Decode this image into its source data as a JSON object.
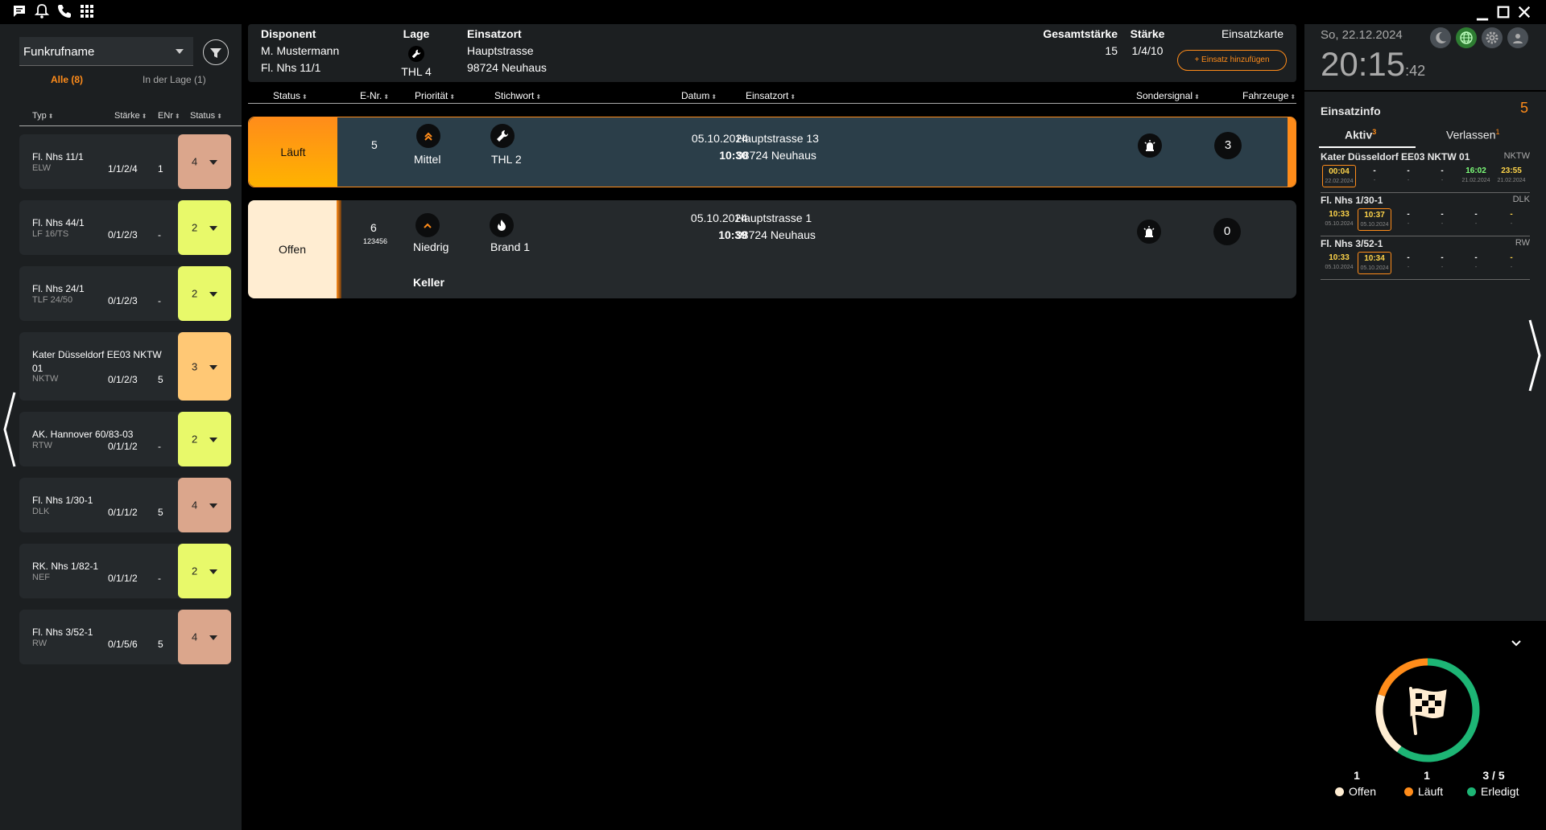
{
  "colors": {
    "accent": "#ff8c1a",
    "status2": "#e8f96a",
    "status3": "#ffc875",
    "status4": "#dba68c",
    "offen": "#ffedd2",
    "laeuft": "#ff8c1a",
    "erledigt": "#1db575",
    "timeGreen": "#7dff7a",
    "timeYellow": "#ffd54a"
  },
  "topbar": {
    "icons": [
      "message-icon",
      "bell-icon",
      "phone-icon",
      "grid-icon"
    ],
    "window": [
      "minimize-icon",
      "maximize-icon",
      "close-icon"
    ]
  },
  "left": {
    "select": {
      "value": "Funkrufname"
    },
    "tabs": [
      {
        "label": "Alle (8)",
        "active": true
      },
      {
        "label": "In der Lage (1)",
        "active": false
      }
    ],
    "columns": [
      "Typ",
      "Stärke",
      "ENr",
      "Status"
    ],
    "units": [
      {
        "name": "Fl. Nhs 11/1",
        "type": "ELW",
        "staerke": "1/1/2/4",
        "enr": "1",
        "status": "4",
        "color": "#dba68c"
      },
      {
        "name": "Fl. Nhs 44/1",
        "type": "LF 16/TS",
        "staerke": "0/1/2/3",
        "enr": "-",
        "status": "2",
        "color": "#e8f96a"
      },
      {
        "name": "Fl. Nhs 24/1",
        "type": "TLF 24/50",
        "staerke": "0/1/2/3",
        "enr": "-",
        "status": "2",
        "color": "#e8f96a"
      },
      {
        "name": "Kater Düsseldorf EE03 NKTW 01",
        "type": "NKTW",
        "staerke": "0/1/2/3",
        "enr": "5",
        "status": "3",
        "color": "#ffc875"
      },
      {
        "name": "AK. Hannover 60/83-03",
        "type": "RTW",
        "staerke": "0/1/1/2",
        "enr": "-",
        "status": "2",
        "color": "#e8f96a"
      },
      {
        "name": "Fl. Nhs 1/30-1",
        "type": "DLK",
        "staerke": "0/1/1/2",
        "enr": "5",
        "status": "4",
        "color": "#dba68c"
      },
      {
        "name": "RK. Nhs 1/82-1",
        "type": "NEF",
        "staerke": "0/1/1/2",
        "enr": "-",
        "status": "2",
        "color": "#e8f96a"
      },
      {
        "name": "Fl. Nhs 3/52-1",
        "type": "RW",
        "staerke": "0/1/5/6",
        "enr": "5",
        "status": "4",
        "color": "#dba68c"
      }
    ]
  },
  "header": {
    "disponent_label": "Disponent",
    "disponent": "M. Mustermann",
    "disponent_unit": "Fl. Nhs 11/1",
    "lage_label": "Lage",
    "lage": "THL 4",
    "einsatzort_label": "Einsatzort",
    "street": "Hauptstrasse",
    "city": "98724 Neuhaus",
    "gesamt_label": "Gesamtstärke",
    "gesamt": "15",
    "staerke_label": "Stärke",
    "staerke": "1/4/10",
    "karte_label": "Einsatzkarte",
    "add_label": "+ Einsatz hinzufügen"
  },
  "table": {
    "columns": [
      "Status",
      "E-Nr.",
      "Priorität",
      "Stichwort",
      "Datum",
      "Einsatzort",
      "Sondersignal",
      "Fahrzeuge"
    ],
    "rows": [
      {
        "status": "Läuft",
        "enr": "5",
        "enr_sub": "",
        "prio": "Mittel",
        "stich": "THL 2",
        "date": "05.10.2024",
        "time": "10:30",
        "street": "Hauptstrasse 13",
        "city": "98724 Neuhaus",
        "fahrzeuge": "3",
        "extra": ""
      },
      {
        "status": "Offen",
        "enr": "6",
        "enr_sub": "123456",
        "prio": "Niedrig",
        "stich": "Brand 1",
        "date": "05.10.2024",
        "time": "10:39",
        "street": "Hauptstrasse 1",
        "city": "98724 Neuhaus",
        "fahrzeuge": "0",
        "extra": "Keller"
      }
    ]
  },
  "right": {
    "date": "So, 22.12.2024",
    "time": "20:15",
    "seconds": ":42",
    "icons": [
      "moon-icon",
      "globe-icon",
      "gear-icon",
      "user-icon"
    ],
    "info_title": "Einsatzinfo",
    "info_count": "5",
    "tabs": [
      {
        "label": "Aktiv",
        "count": "3"
      },
      {
        "label": "Verlassen",
        "count": "1"
      }
    ],
    "entries": [
      {
        "name": "Kater Düsseldorf EE03 NKTW 01",
        "type": "NKTW",
        "times": [
          "00:04",
          "-",
          "-",
          "-",
          "16:02",
          "23:55"
        ],
        "dates": [
          "22.02.2024",
          "-",
          "-",
          "-",
          "21.02.2024",
          "21.02.2024"
        ]
      },
      {
        "name": "Fl. Nhs 1/30-1",
        "type": "DLK",
        "times": [
          "10:33",
          "10:37",
          "-",
          "-",
          "-",
          "-"
        ],
        "dates": [
          "05.10.2024",
          "05.10.2024",
          "-",
          "-",
          "-",
          "-"
        ]
      },
      {
        "name": "Fl. Nhs 3/52-1",
        "type": "RW",
        "times": [
          "10:33",
          "10:34",
          "-",
          "-",
          "-",
          "-"
        ],
        "dates": [
          "05.10.2024",
          "05.10.2024",
          "-",
          "-",
          "-",
          "-"
        ]
      }
    ],
    "summary": {
      "offen": 1,
      "laeuft": 1,
      "erledigt": 3,
      "total": 5,
      "offen_label": "Offen",
      "laeuft_label": "Läuft",
      "erledigt_label": "Erledigt",
      "offen_value": "1",
      "laeuft_value": "1",
      "erledigt_value": "3 / 5"
    }
  }
}
